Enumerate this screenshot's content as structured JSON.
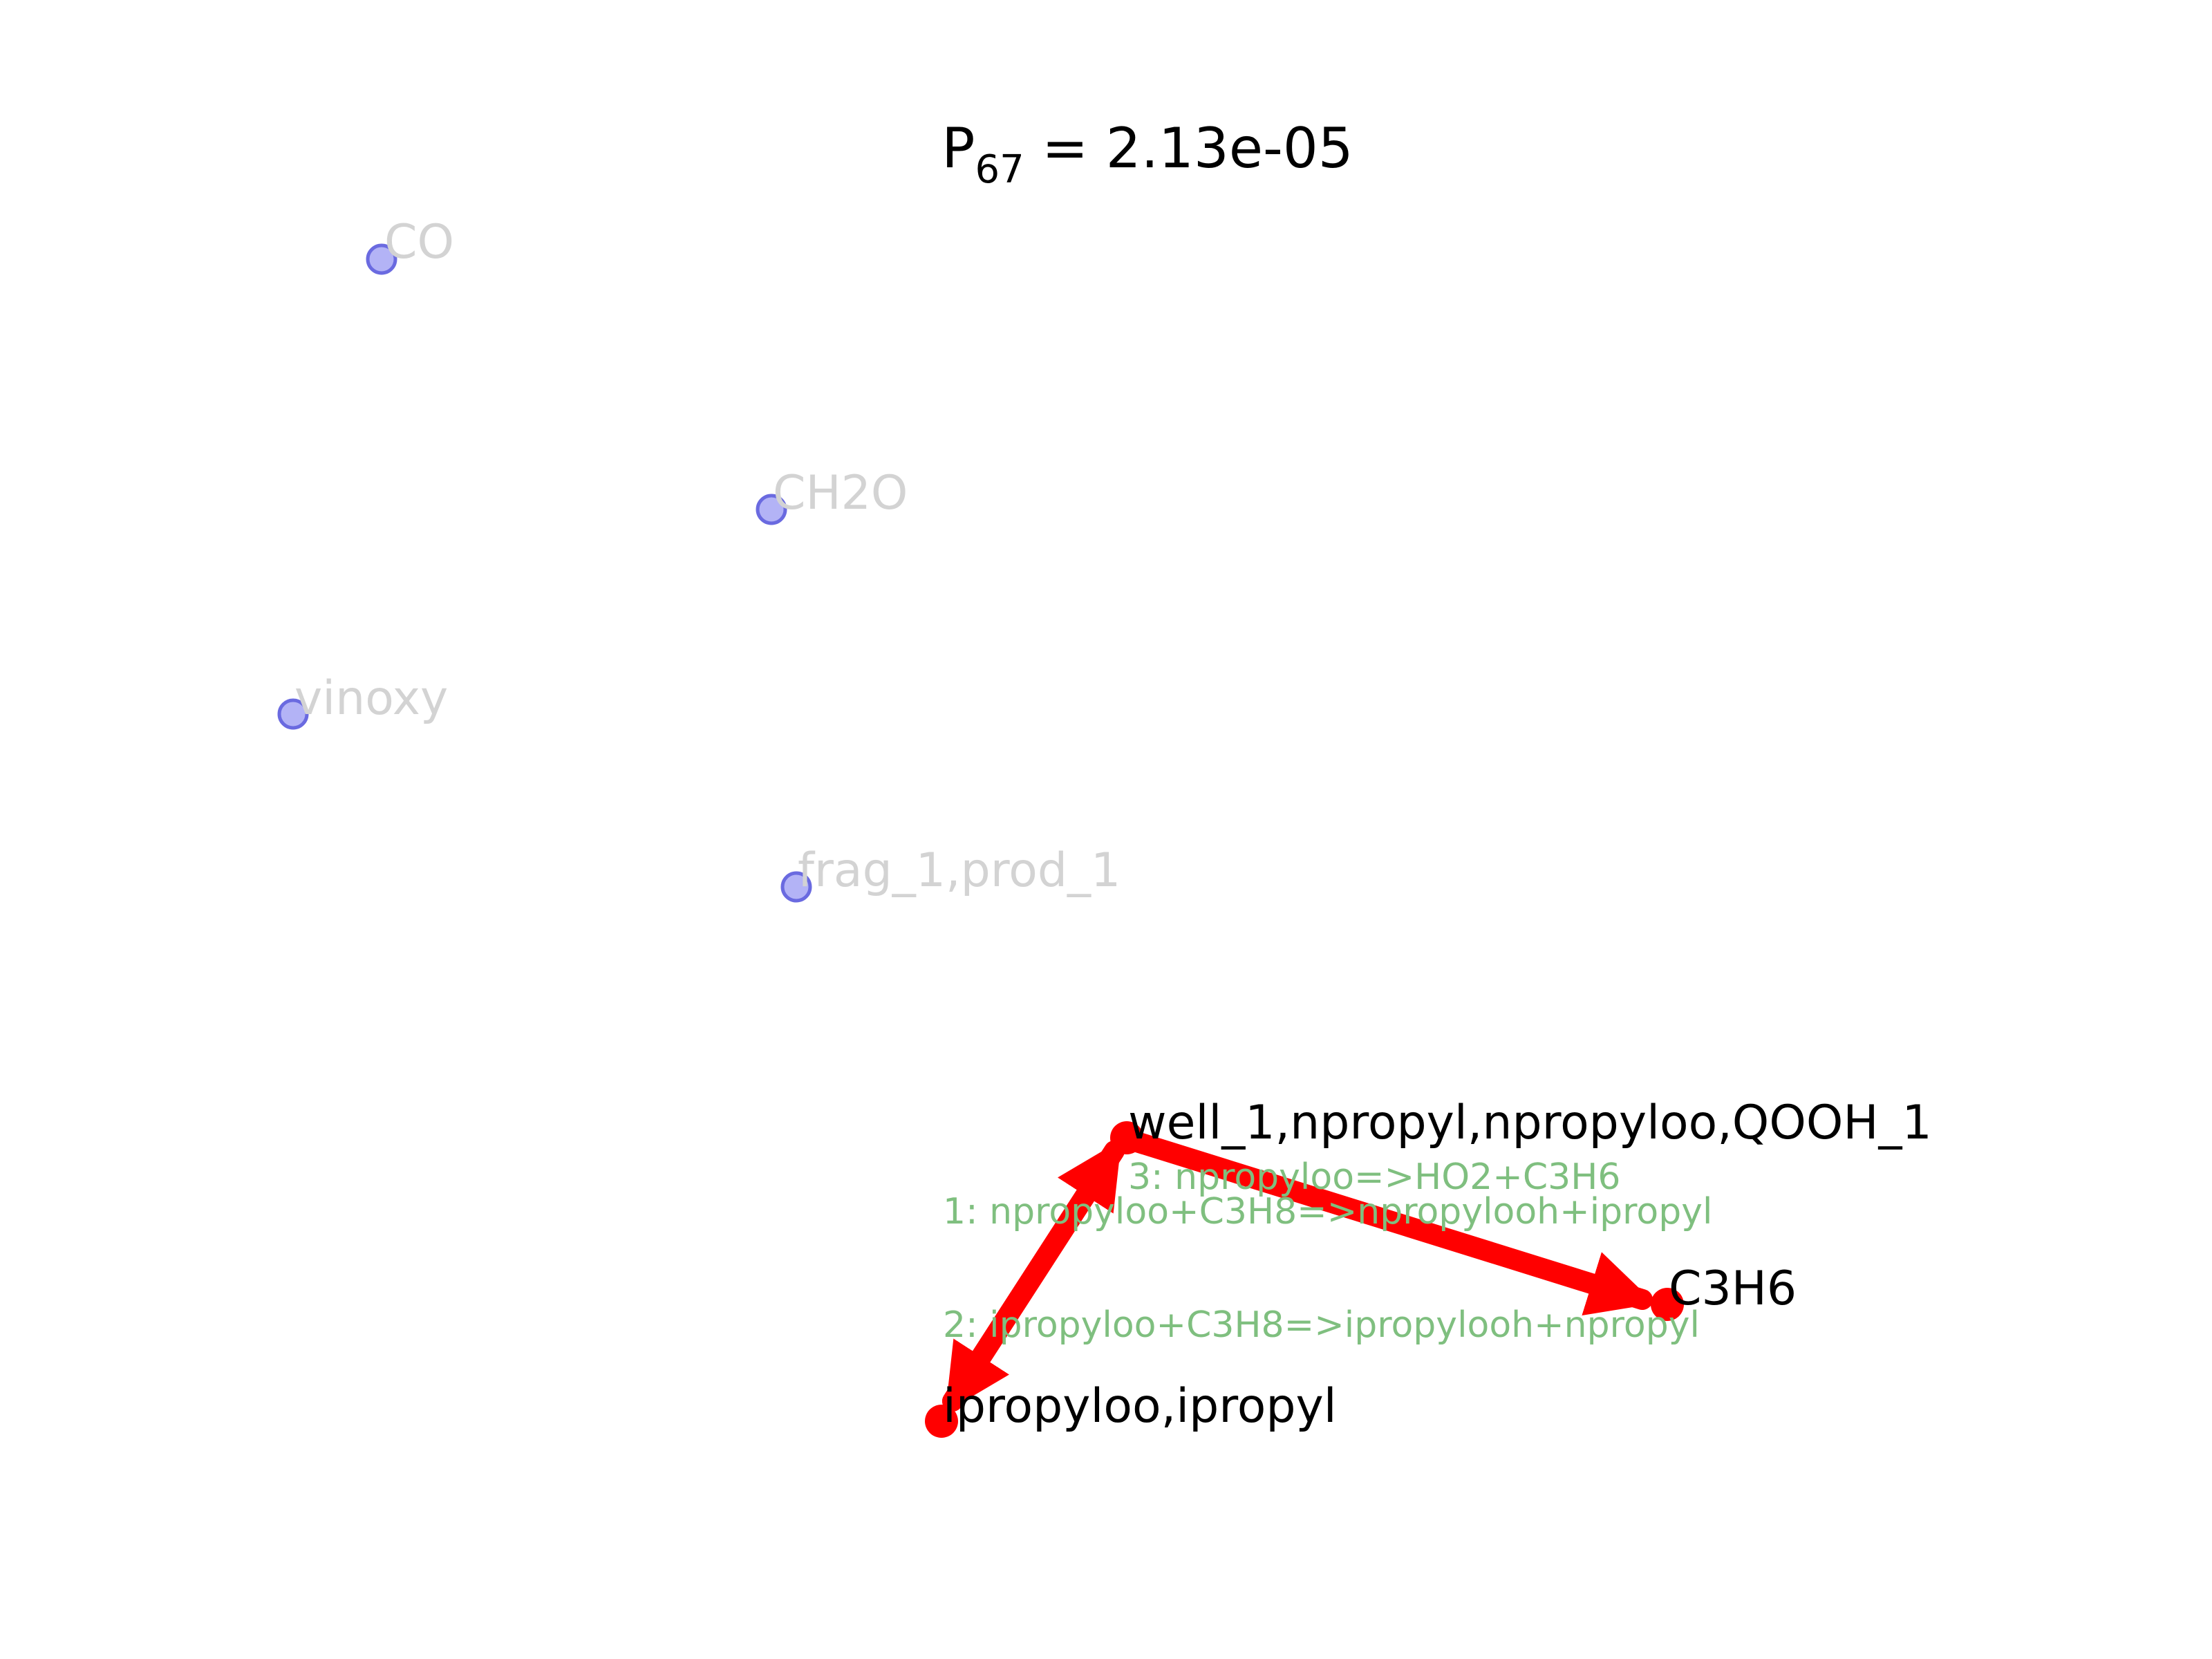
{
  "title": {
    "prefix": "P",
    "subscript": "67",
    "suffix": " = 2.13e-05"
  },
  "colors": {
    "active_node": "#ff0000",
    "inactive_node": "#8080f0",
    "inactive_label": "#d3d3d3",
    "active_label": "#000000",
    "edge": "#ff0000",
    "edge_label": "#7fbf7f"
  },
  "nodes": [
    {
      "id": "co",
      "label": "CO",
      "active": false
    },
    {
      "id": "ch2o",
      "label": "CH2O",
      "active": false
    },
    {
      "id": "vinoxy",
      "label": "vinoxy",
      "active": false
    },
    {
      "id": "frag",
      "label": "frag_1,prod_1",
      "active": false
    },
    {
      "id": "well",
      "label": "well_1,npropyl,npropyloo,QOOH_1",
      "active": true
    },
    {
      "id": "c3h6",
      "label": "C3H6",
      "active": true
    },
    {
      "id": "ipropyl",
      "label": "ipropyloo,ipropyl",
      "active": true
    }
  ],
  "edges": [
    {
      "label": "1: npropyloo+C3H8=>npropylooh+ipropyl"
    },
    {
      "label": "2: ipropyloo+C3H8=>ipropylooh+npropyl"
    },
    {
      "label": "3: npropyloo=>HO2+C3H6"
    }
  ]
}
